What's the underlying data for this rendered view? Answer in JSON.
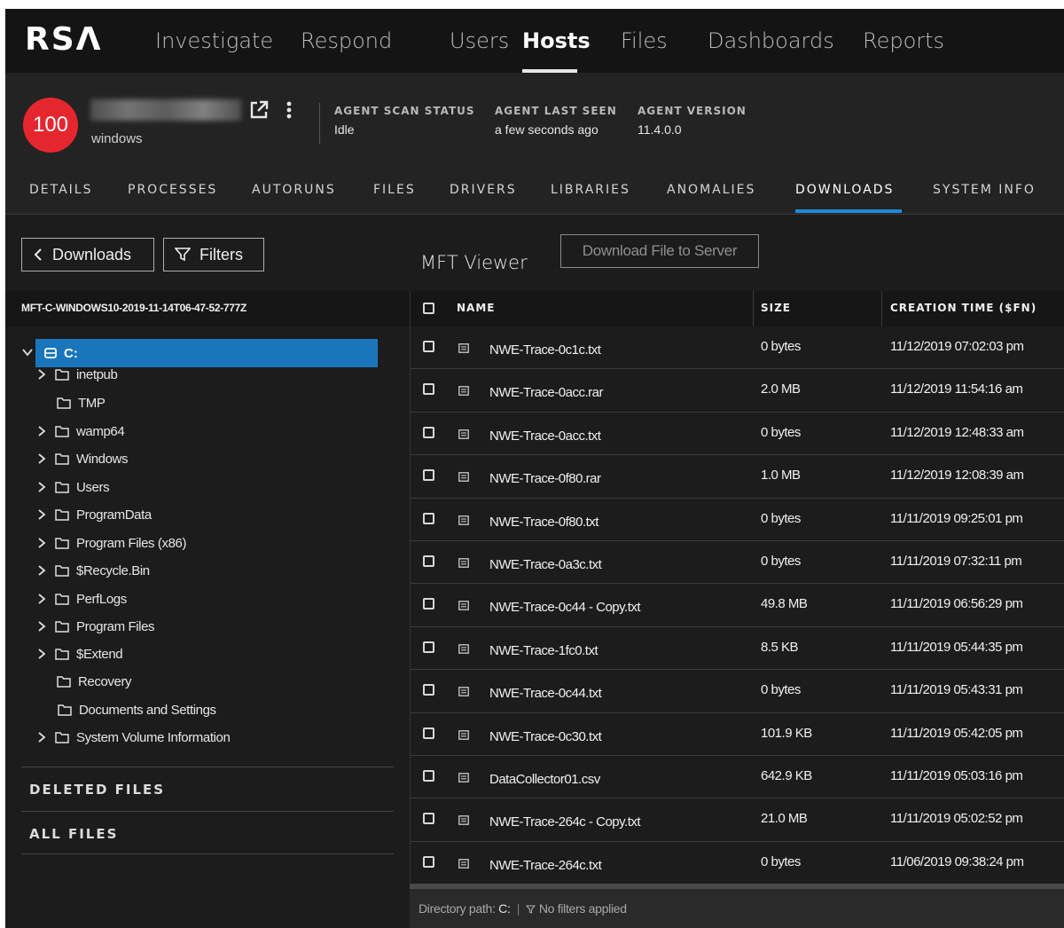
{
  "app": {
    "logo": "RSΛ"
  },
  "nav": {
    "items": [
      {
        "label": "Investigate",
        "active": false
      },
      {
        "label": "Respond",
        "active": false
      },
      {
        "label": "Users",
        "active": false
      },
      {
        "label": "Hosts",
        "active": true
      },
      {
        "label": "Files",
        "active": false
      },
      {
        "label": "Dashboards",
        "active": false
      },
      {
        "label": "Reports",
        "active": false
      }
    ]
  },
  "host": {
    "risk_score": "100",
    "os": "windows",
    "icons": [
      "external-link-icon",
      "more-vertical-icon"
    ],
    "meta": [
      {
        "label": "AGENT SCAN STATUS",
        "value": "Idle"
      },
      {
        "label": "AGENT LAST SEEN",
        "value": "a few seconds ago"
      },
      {
        "label": "AGENT VERSION",
        "value": "11.4.0.0"
      }
    ]
  },
  "tabs": [
    {
      "label": "DETAILS",
      "active": false
    },
    {
      "label": "PROCESSES",
      "active": false
    },
    {
      "label": "AUTORUNS",
      "active": false
    },
    {
      "label": "FILES",
      "active": false
    },
    {
      "label": "DRIVERS",
      "active": false
    },
    {
      "label": "LIBRARIES",
      "active": false
    },
    {
      "label": "ANOMALIES",
      "active": false
    },
    {
      "label": "DOWNLOADS",
      "active": true
    },
    {
      "label": "SYSTEM INFO",
      "active": false
    }
  ],
  "left": {
    "back_button": "Downloads",
    "filters_button": "Filters",
    "mft_name": "MFT-C-WINDOWS10-2019-11-14T06-47-52-777Z",
    "tree": {
      "root": "C:",
      "items": [
        {
          "label": "inetpub",
          "expandable": true
        },
        {
          "label": "TMP",
          "expandable": false
        },
        {
          "label": "wamp64",
          "expandable": true
        },
        {
          "label": "Windows",
          "expandable": true
        },
        {
          "label": "Users",
          "expandable": true
        },
        {
          "label": "ProgramData",
          "expandable": true
        },
        {
          "label": "Program Files (x86)",
          "expandable": true
        },
        {
          "label": "$Recycle.Bin",
          "expandable": true
        },
        {
          "label": "PerfLogs",
          "expandable": true
        },
        {
          "label": "Program Files",
          "expandable": true
        },
        {
          "label": "$Extend",
          "expandable": true
        },
        {
          "label": "Recovery",
          "expandable": false
        },
        {
          "label": "Documents and Settings",
          "expandable": false
        },
        {
          "label": "System Volume Information",
          "expandable": true
        }
      ]
    },
    "sections": [
      "DELETED FILES",
      "ALL FILES"
    ]
  },
  "viewer": {
    "title": "MFT Viewer",
    "download_button": "Download File to Server",
    "columns": [
      "NAME",
      "SIZE",
      "CREATION TIME ($FN)"
    ],
    "rows": [
      {
        "name": "NWE-Trace-0c1c.txt",
        "size": "0 bytes",
        "time": "11/12/2019 07:02:03 pm"
      },
      {
        "name": "NWE-Trace-0acc.rar",
        "size": "2.0 MB",
        "time": "11/12/2019 11:54:16 am"
      },
      {
        "name": "NWE-Trace-0acc.txt",
        "size": "0 bytes",
        "time": "11/12/2019 12:48:33 am"
      },
      {
        "name": "NWE-Trace-0f80.rar",
        "size": "1.0 MB",
        "time": "11/12/2019 12:08:39 am"
      },
      {
        "name": "NWE-Trace-0f80.txt",
        "size": "0 bytes",
        "time": "11/11/2019 09:25:01 pm"
      },
      {
        "name": "NWE-Trace-0a3c.txt",
        "size": "0 bytes",
        "time": "11/11/2019 07:32:11 pm"
      },
      {
        "name": "NWE-Trace-0c44 - Copy.txt",
        "size": "49.8 MB",
        "time": "11/11/2019 06:56:29 pm"
      },
      {
        "name": "NWE-Trace-1fc0.txt",
        "size": "8.5 KB",
        "time": "11/11/2019 05:44:35 pm"
      },
      {
        "name": "NWE-Trace-0c44.txt",
        "size": "0 bytes",
        "time": "11/11/2019 05:43:31 pm"
      },
      {
        "name": "NWE-Trace-0c30.txt",
        "size": "101.9 KB",
        "time": "11/11/2019 05:42:05 pm"
      },
      {
        "name": "DataCollector01.csv",
        "size": "642.9 KB",
        "time": "11/11/2019 05:03:16 pm"
      },
      {
        "name": "NWE-Trace-264c - Copy.txt",
        "size": "21.0 MB",
        "time": "11/11/2019 05:02:52 pm"
      },
      {
        "name": "NWE-Trace-264c.txt",
        "size": "0 bytes",
        "time": "11/06/2019 09:38:24 pm"
      }
    ],
    "status": {
      "path_label": "Directory path:",
      "path_value": "C:",
      "filter_text": "No filters applied"
    }
  },
  "colors": {
    "accent": "#1a76bc",
    "risk": "#e6262e",
    "background": "#1c1c1c"
  }
}
